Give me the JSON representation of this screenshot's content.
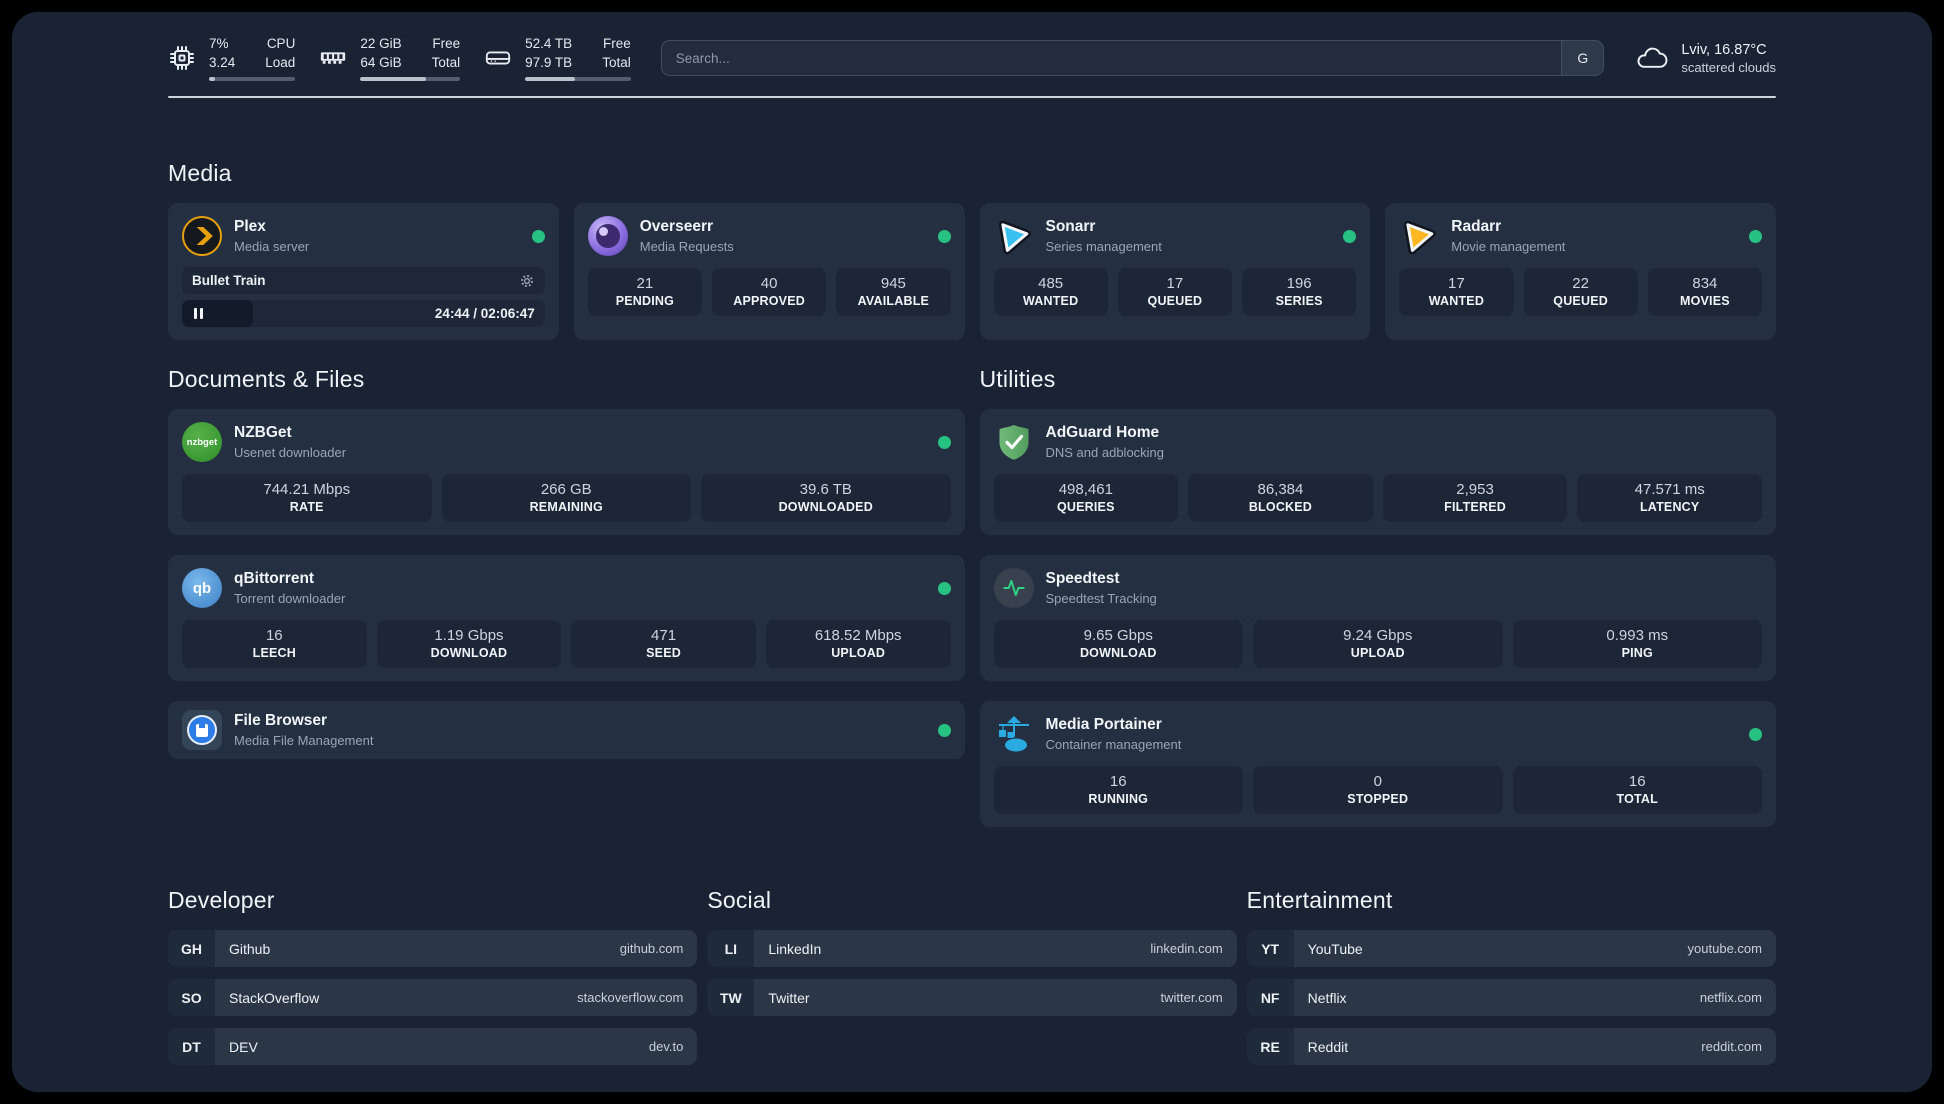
{
  "topbar": {
    "cpu": {
      "usage": "7%",
      "load": "3.24",
      "label1": "CPU",
      "label2": "Load",
      "progress": 7
    },
    "memory": {
      "free": "22 GiB",
      "total": "64 GiB",
      "label1": "Free",
      "label2": "Total",
      "progress": 66
    },
    "disk": {
      "free": "52.4 TB",
      "total": "97.9 TB",
      "label1": "Free",
      "label2": "Total",
      "progress": 47
    },
    "search": {
      "placeholder": "Search...",
      "engine": "G"
    },
    "weather": {
      "location": "Lviv, 16.87°C",
      "condition": "scattered clouds"
    }
  },
  "sections": {
    "media": "Media",
    "documents": "Documents & Files",
    "utilities": "Utilities",
    "developer": "Developer",
    "social": "Social",
    "entertainment": "Entertainment"
  },
  "apps": {
    "plex": {
      "title": "Plex",
      "subtitle": "Media server",
      "now_playing": "Bullet Train",
      "time": "24:44 / 02:06:47",
      "progress": 19.5
    },
    "overseerr": {
      "title": "Overseerr",
      "subtitle": "Media Requests",
      "stats": [
        {
          "value": "21",
          "label": "PENDING"
        },
        {
          "value": "40",
          "label": "APPROVED"
        },
        {
          "value": "945",
          "label": "AVAILABLE"
        }
      ]
    },
    "sonarr": {
      "title": "Sonarr",
      "subtitle": "Series management",
      "stats": [
        {
          "value": "485",
          "label": "WANTED"
        },
        {
          "value": "17",
          "label": "QUEUED"
        },
        {
          "value": "196",
          "label": "SERIES"
        }
      ]
    },
    "radarr": {
      "title": "Radarr",
      "subtitle": "Movie management",
      "stats": [
        {
          "value": "17",
          "label": "WANTED"
        },
        {
          "value": "22",
          "label": "QUEUED"
        },
        {
          "value": "834",
          "label": "MOVIES"
        }
      ]
    },
    "nzbget": {
      "title": "NZBGet",
      "subtitle": "Usenet downloader",
      "icon_text": "nzbget",
      "stats": [
        {
          "value": "744.21 Mbps",
          "label": "RATE"
        },
        {
          "value": "266 GB",
          "label": "REMAINING"
        },
        {
          "value": "39.6 TB",
          "label": "DOWNLOADED"
        }
      ]
    },
    "qbittorrent": {
      "title": "qBittorrent",
      "subtitle": "Torrent downloader",
      "icon_text": "qb",
      "stats": [
        {
          "value": "16",
          "label": "LEECH"
        },
        {
          "value": "1.19 Gbps",
          "label": "DOWNLOAD"
        },
        {
          "value": "471",
          "label": "SEED"
        },
        {
          "value": "618.52 Mbps",
          "label": "UPLOAD"
        }
      ]
    },
    "filebrowser": {
      "title": "File Browser",
      "subtitle": "Media File Management"
    },
    "adguard": {
      "title": "AdGuard Home",
      "subtitle": "DNS and adblocking",
      "stats": [
        {
          "value": "498,461",
          "label": "QUERIES"
        },
        {
          "value": "86,384",
          "label": "BLOCKED"
        },
        {
          "value": "2,953",
          "label": "FILTERED"
        },
        {
          "value": "47.571 ms",
          "label": "LATENCY"
        }
      ]
    },
    "speedtest": {
      "title": "Speedtest",
      "subtitle": "Speedtest Tracking",
      "stats": [
        {
          "value": "9.65 Gbps",
          "label": "DOWNLOAD"
        },
        {
          "value": "9.24 Gbps",
          "label": "UPLOAD"
        },
        {
          "value": "0.993 ms",
          "label": "PING"
        }
      ]
    },
    "portainer": {
      "title": "Media Portainer",
      "subtitle": "Container management",
      "stats": [
        {
          "value": "16",
          "label": "RUNNING"
        },
        {
          "value": "0",
          "label": "STOPPED"
        },
        {
          "value": "16",
          "label": "TOTAL"
        }
      ]
    }
  },
  "bookmarks": {
    "developer": [
      {
        "abbr": "GH",
        "name": "Github",
        "url": "github.com"
      },
      {
        "abbr": "SO",
        "name": "StackOverflow",
        "url": "stackoverflow.com"
      },
      {
        "abbr": "DT",
        "name": "DEV",
        "url": "dev.to"
      }
    ],
    "social": [
      {
        "abbr": "LI",
        "name": "LinkedIn",
        "url": "linkedin.com"
      },
      {
        "abbr": "TW",
        "name": "Twitter",
        "url": "twitter.com"
      }
    ],
    "entertainment": [
      {
        "abbr": "YT",
        "name": "YouTube",
        "url": "youtube.com"
      },
      {
        "abbr": "NF",
        "name": "Netflix",
        "url": "netflix.com"
      },
      {
        "abbr": "RE",
        "name": "Reddit",
        "url": "reddit.com"
      }
    ]
  },
  "colors": {
    "status_online": "#27c281",
    "plex": "#e7a00d",
    "sonarr": "#38c1f1",
    "radarr": "#ffb822",
    "nzbget": "#3e9e33",
    "qbittorrent": "#4e9de0",
    "adguard": "#67b279",
    "speedtest_pulse": "#2ed584",
    "filebrowser": "#2d7ce8",
    "portainer": "#29abe2",
    "overseerr": "#7c5cc4"
  }
}
